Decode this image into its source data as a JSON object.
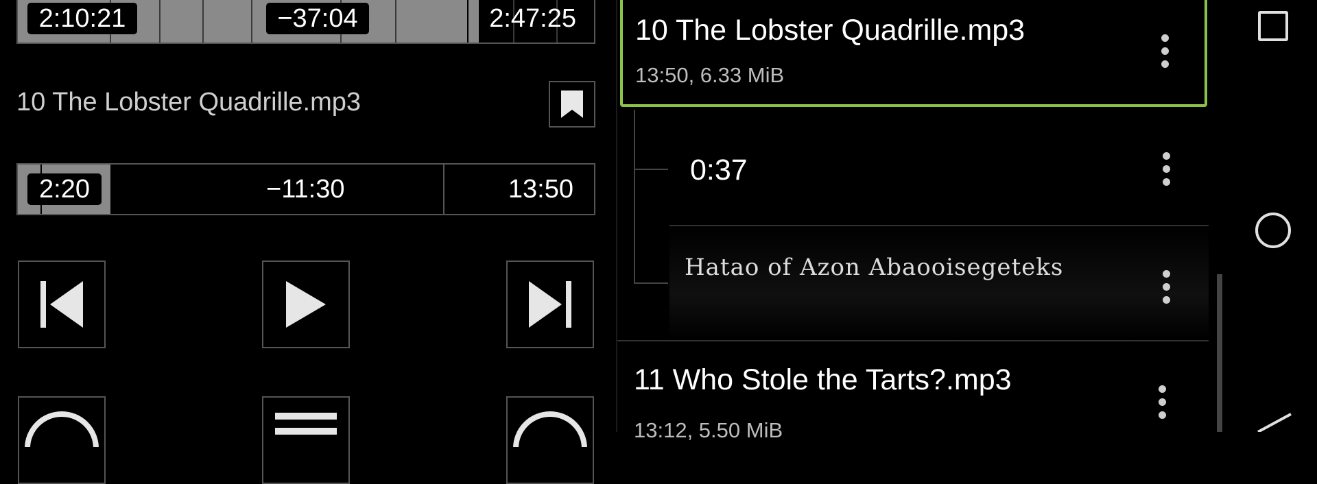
{
  "player": {
    "overall": {
      "elapsed": "2:10:21",
      "remaining": "−37:04",
      "total": "2:47:25",
      "progress_fraction": 0.78
    },
    "track_title": "10 The Lobster Quadrille.mp3",
    "track": {
      "elapsed": "2:20",
      "remaining": "−11:30",
      "total": "13:50",
      "progress_fraction": 0.17
    },
    "controls": {
      "previous_icon": "skip-previous-icon",
      "play_icon": "play-icon",
      "next_icon": "skip-next-icon"
    }
  },
  "list": {
    "selected_item": {
      "title": "10 The Lobster Quadrille.mp3",
      "meta": "13:50, 6.33 MiB"
    },
    "bookmarks": [
      {
        "label": "0:37"
      },
      {
        "label": "Hatao of Azon Abaooisegeteks"
      }
    ],
    "next_item": {
      "title": "11 Who Stole the Tarts?.mp3",
      "meta": "13:12, 5.50 MiB"
    },
    "accent_color": "#8bc34a"
  },
  "nav": {
    "recents_icon": "recents-icon",
    "home_icon": "home-icon",
    "back_icon": "back-icon"
  }
}
